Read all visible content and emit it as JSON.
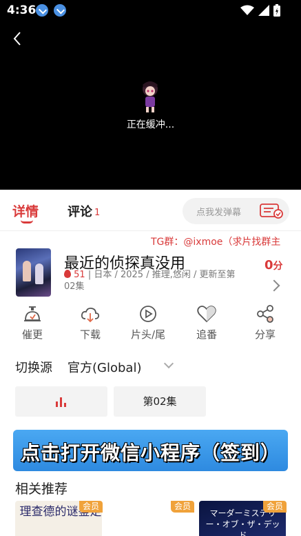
{
  "status_bar": {
    "time": "4:36"
  },
  "player": {
    "buffer_text": "正在缓冲..."
  },
  "tabs": {
    "detail": "详情",
    "comment": "评论",
    "comment_count": "1"
  },
  "danmaku": {
    "placeholder": "点我发弹幕"
  },
  "marquee": "TG群：@ixmoe（求片找群主",
  "info": {
    "title": "最近的侦探真没用",
    "score": "0",
    "score_unit": "分",
    "heat": "51",
    "meta": "| 日本 / 2025 / 推理,悠闲 / 更新至第02集"
  },
  "actions": [
    {
      "label": "催更",
      "icon": "timer-bell-icon"
    },
    {
      "label": "下载",
      "icon": "cloud-download-icon"
    },
    {
      "label": "片头/尾",
      "icon": "play-circle-icon"
    },
    {
      "label": "追番",
      "icon": "heart-icon"
    },
    {
      "label": "分享",
      "icon": "share-icon"
    }
  ],
  "source": {
    "label": "切换源",
    "value": "官方(Global)"
  },
  "episodes": {
    "current": "第02集"
  },
  "banner": "点击打开微信小程序（签到）",
  "recommend": {
    "title": "相关推荐",
    "badge": "会员",
    "card1_text": "理查德的谜鉴定",
    "card2_text": "マーダーミステリー・オブ・ザ・デッド"
  },
  "colors": {
    "accent": "#d93a3a",
    "banner": "#3b9be8",
    "vip": "#f0a23a"
  }
}
